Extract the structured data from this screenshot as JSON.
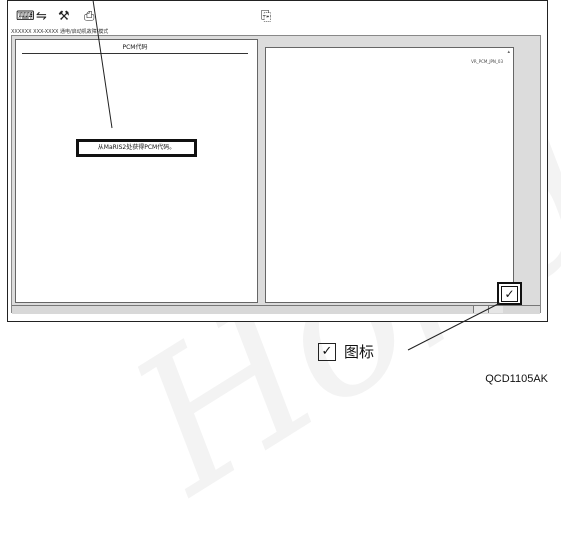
{
  "toolbar": {
    "icons": [
      {
        "name": "computer-icon",
        "glyph": "⌨"
      },
      {
        "name": "network-icon",
        "glyph": "⇋"
      },
      {
        "name": "tool-icon",
        "glyph": "⚒"
      },
      {
        "name": "pcm-icon",
        "glyph": "⎙"
      },
      {
        "name": "help-icon",
        "glyph": "⎘"
      }
    ]
  },
  "app_title": "XXXXXX XXX-XXXX 通电/启动机故障 模式",
  "left_panel": {
    "header": "PCM代码",
    "notice": "从MaRIS2处获得PCM代码。"
  },
  "right_panel": {
    "code": "VR_PCM_JPN_03"
  },
  "check_button": {
    "glyph": "✓"
  },
  "legend": {
    "glyph": "✓",
    "label": "图标"
  },
  "figure_id": "QCD1105AK"
}
